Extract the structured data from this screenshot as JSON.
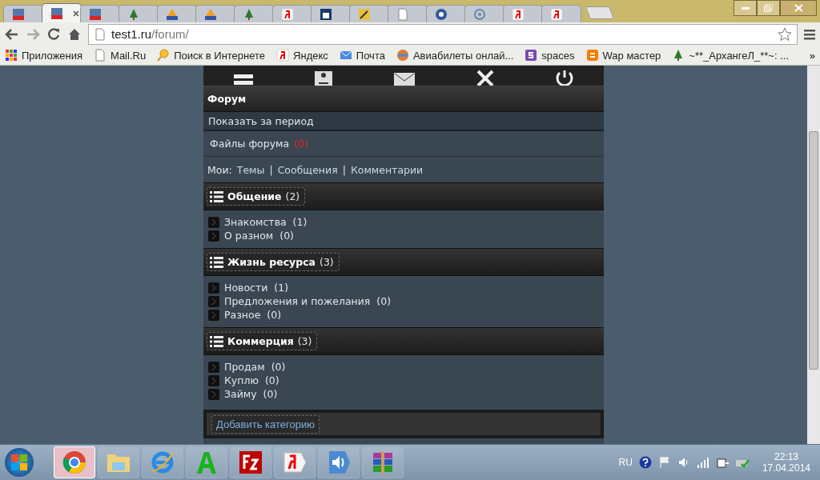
{
  "browser": {
    "tabs": [
      {
        "kind": "cms",
        "selected": false
      },
      {
        "kind": "cms",
        "selected": true
      },
      {
        "kind": "cms",
        "selected": false
      },
      {
        "kind": "tree",
        "selected": false
      },
      {
        "kind": "pma",
        "selected": false
      },
      {
        "kind": "pma",
        "selected": false
      },
      {
        "kind": "tree",
        "selected": false
      },
      {
        "kind": "yandex",
        "selected": false
      },
      {
        "kind": "site",
        "selected": false
      },
      {
        "kind": "tool",
        "selected": false
      },
      {
        "kind": "page",
        "selected": false
      },
      {
        "kind": "gear",
        "selected": false
      },
      {
        "kind": "wifi",
        "selected": false
      },
      {
        "kind": "yandex",
        "selected": false
      },
      {
        "kind": "yandex",
        "selected": false
      }
    ],
    "address": {
      "host": "test1.ru",
      "path": "/forum/"
    },
    "bookmarks": [
      {
        "kind": "apps",
        "label": "Приложения"
      },
      {
        "kind": "page",
        "label": "Mail.Ru"
      },
      {
        "kind": "search",
        "label": "Поиск в Интернете"
      },
      {
        "kind": "yandex",
        "label": "Яндекс"
      },
      {
        "kind": "mail",
        "label": "Почта"
      },
      {
        "kind": "plane",
        "label": "Авиабилеты онлай..."
      },
      {
        "kind": "spaces",
        "label": "spaces"
      },
      {
        "kind": "blogger",
        "label": "Wap мастер"
      },
      {
        "kind": "tree",
        "label": "~**_АрхангеЛ_**~: ..."
      }
    ],
    "more": "»"
  },
  "forum": {
    "title": "Форум",
    "period_link": "Показать за период",
    "files": {
      "label": "Файлы форума",
      "count": "(0)"
    },
    "my": {
      "label": "Мои:",
      "links": [
        "Темы",
        "Сообщения",
        "Комментарии"
      ],
      "separator": "|"
    },
    "categories": [
      {
        "name": "Общение",
        "count": "(2)",
        "forums": [
          {
            "name": "Знакомства",
            "count": "(1)"
          },
          {
            "name": "О разном",
            "count": "(0)"
          }
        ]
      },
      {
        "name": "Жизнь ресурса",
        "count": "(3)",
        "forums": [
          {
            "name": "Новости",
            "count": "(1)"
          },
          {
            "name": "Предложения и пожелания",
            "count": "(0)"
          },
          {
            "name": "Разное",
            "count": "(0)"
          }
        ]
      },
      {
        "name": "Коммерция",
        "count": "(3)",
        "forums": [
          {
            "name": "Продам",
            "count": "(0)"
          },
          {
            "name": "Куплю",
            "count": "(0)"
          },
          {
            "name": "Займу",
            "count": "(0)"
          }
        ]
      }
    ],
    "add_category_button": "Добавить категорию"
  },
  "taskbar": {
    "apps": [
      {
        "kind": "chrome",
        "selected": true
      },
      {
        "kind": "folder",
        "selected": false
      },
      {
        "kind": "ie",
        "selected": false
      },
      {
        "kind": "a",
        "selected": false
      },
      {
        "kind": "filezilla",
        "selected": false
      },
      {
        "kind": "yandex",
        "selected": false
      },
      {
        "kind": "sound",
        "selected": false
      },
      {
        "kind": "winrar",
        "selected": false
      }
    ],
    "language": "RU",
    "time": "22:13",
    "date": "17.04.2014"
  }
}
